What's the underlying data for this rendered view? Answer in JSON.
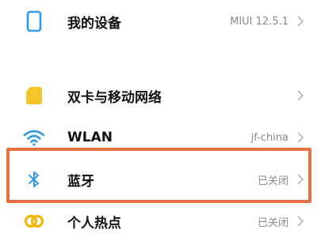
{
  "settings": {
    "items": [
      {
        "id": "device",
        "label": "我的设备",
        "value": "MIUI 12.5.1",
        "icon": "phone-outline-icon"
      },
      {
        "id": "sim",
        "label": "双卡与移动网络",
        "value": "",
        "icon": "sim-card-icon"
      },
      {
        "id": "wlan",
        "label": "WLAN",
        "value": "jf-china",
        "icon": "wifi-icon"
      },
      {
        "id": "bluetooth",
        "label": "蓝牙",
        "value": "已关闭",
        "icon": "bluetooth-icon"
      },
      {
        "id": "hotspot",
        "label": "个人热点",
        "value": "已关闭",
        "icon": "hotspot-rings-icon"
      }
    ]
  },
  "colors": {
    "accent_blue": "#2f9be8",
    "sim_yellow": "#f5c428",
    "hotspot_yellow": "#f2b705",
    "highlight_orange": "#e8703f",
    "chevron": "#b5b5b5"
  }
}
